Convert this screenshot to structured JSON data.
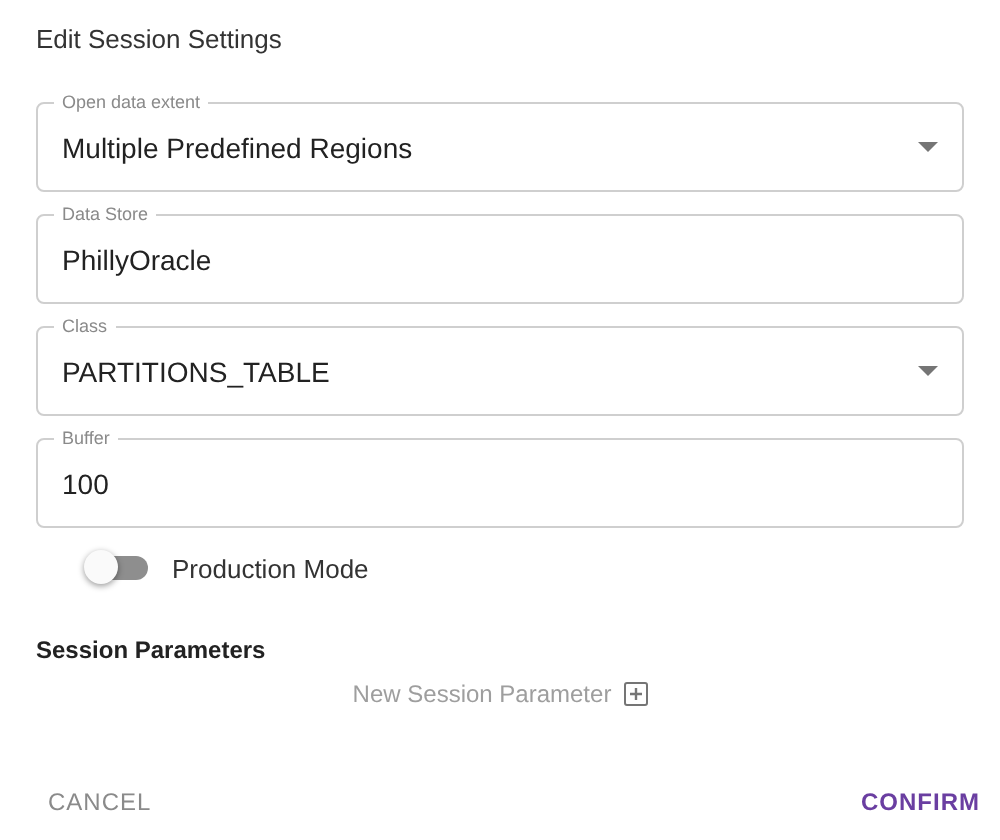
{
  "dialog": {
    "title": "Edit Session Settings"
  },
  "fields": [
    {
      "kind": "select",
      "label": "Open data extent",
      "value": "Multiple Predefined Regions"
    },
    {
      "kind": "text",
      "label": "Data Store",
      "value": "PhillyOracle"
    },
    {
      "kind": "select",
      "label": "Class",
      "value": "PARTITIONS_TABLE"
    },
    {
      "kind": "text",
      "label": "Buffer",
      "value": "100"
    }
  ],
  "toggle": {
    "label": "Production Mode",
    "on": false
  },
  "session_parameters": {
    "heading": "Session Parameters",
    "add_label": "New Session Parameter"
  },
  "buttons": [
    {
      "kind": "secondary",
      "label": "CANCEL"
    },
    {
      "kind": "primary",
      "label": "CONFIRM"
    }
  ]
}
